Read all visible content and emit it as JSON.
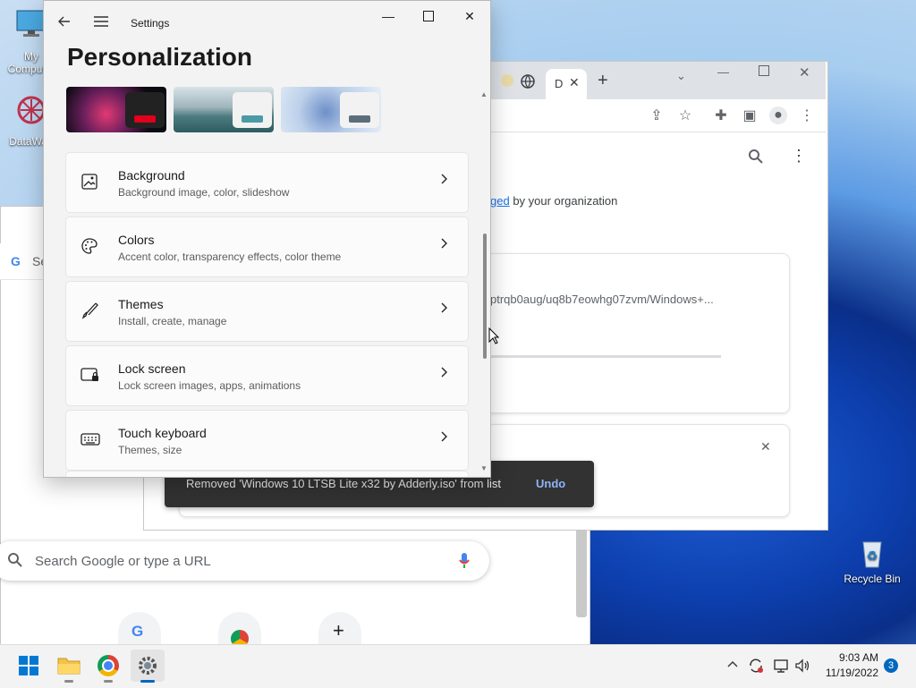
{
  "desktop": {
    "icons": [
      {
        "label": "My Computer"
      },
      {
        "label": "DataWag"
      },
      {
        "label": "Recycle Bin"
      }
    ]
  },
  "chrome": {
    "tab_label": "D",
    "managed_text_link": "ged",
    "managed_text_rest": " by your organization",
    "download_path": "ptrqb0aug/uq8b7eowhg07zvm/Windows+...",
    "search_placeholder": "Search Google or type a URL",
    "bg_search_stub": "Se"
  },
  "toast": {
    "message": "Removed 'Windows 10 LTSB Lite x32 by Adderly.iso' from list",
    "undo": "Undo"
  },
  "settings": {
    "app_title": "Settings",
    "page_title": "Personalization",
    "items": [
      {
        "title": "Background",
        "subtitle": "Background image, color, slideshow"
      },
      {
        "title": "Colors",
        "subtitle": "Accent color, transparency effects, color theme"
      },
      {
        "title": "Themes",
        "subtitle": "Install, create, manage"
      },
      {
        "title": "Lock screen",
        "subtitle": "Lock screen images, apps, animations"
      },
      {
        "title": "Touch keyboard",
        "subtitle": "Themes, size"
      }
    ]
  },
  "taskbar": {
    "time": "9:03 AM",
    "date": "11/19/2022",
    "notification_count": "3"
  },
  "colors": {
    "accent": "#0067c0",
    "toast_bg": "#323232",
    "undo": "#8ab4f8"
  }
}
